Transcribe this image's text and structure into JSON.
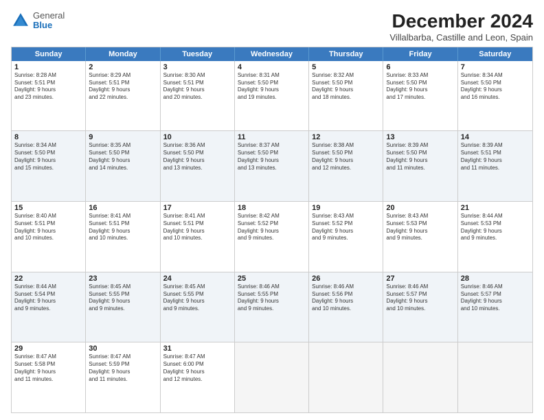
{
  "logo": {
    "general": "General",
    "blue": "Blue"
  },
  "title": "December 2024",
  "subtitle": "Villalbarba, Castille and Leon, Spain",
  "header_days": [
    "Sunday",
    "Monday",
    "Tuesday",
    "Wednesday",
    "Thursday",
    "Friday",
    "Saturday"
  ],
  "rows": [
    [
      {
        "day": "1",
        "lines": [
          "Sunrise: 8:28 AM",
          "Sunset: 5:51 PM",
          "Daylight: 9 hours",
          "and 23 minutes."
        ],
        "alt": false
      },
      {
        "day": "2",
        "lines": [
          "Sunrise: 8:29 AM",
          "Sunset: 5:51 PM",
          "Daylight: 9 hours",
          "and 22 minutes."
        ],
        "alt": false
      },
      {
        "day": "3",
        "lines": [
          "Sunrise: 8:30 AM",
          "Sunset: 5:51 PM",
          "Daylight: 9 hours",
          "and 20 minutes."
        ],
        "alt": false
      },
      {
        "day": "4",
        "lines": [
          "Sunrise: 8:31 AM",
          "Sunset: 5:50 PM",
          "Daylight: 9 hours",
          "and 19 minutes."
        ],
        "alt": false
      },
      {
        "day": "5",
        "lines": [
          "Sunrise: 8:32 AM",
          "Sunset: 5:50 PM",
          "Daylight: 9 hours",
          "and 18 minutes."
        ],
        "alt": false
      },
      {
        "day": "6",
        "lines": [
          "Sunrise: 8:33 AM",
          "Sunset: 5:50 PM",
          "Daylight: 9 hours",
          "and 17 minutes."
        ],
        "alt": false
      },
      {
        "day": "7",
        "lines": [
          "Sunrise: 8:34 AM",
          "Sunset: 5:50 PM",
          "Daylight: 9 hours",
          "and 16 minutes."
        ],
        "alt": false
      }
    ],
    [
      {
        "day": "8",
        "lines": [
          "Sunrise: 8:34 AM",
          "Sunset: 5:50 PM",
          "Daylight: 9 hours",
          "and 15 minutes."
        ],
        "alt": true
      },
      {
        "day": "9",
        "lines": [
          "Sunrise: 8:35 AM",
          "Sunset: 5:50 PM",
          "Daylight: 9 hours",
          "and 14 minutes."
        ],
        "alt": true
      },
      {
        "day": "10",
        "lines": [
          "Sunrise: 8:36 AM",
          "Sunset: 5:50 PM",
          "Daylight: 9 hours",
          "and 13 minutes."
        ],
        "alt": true
      },
      {
        "day": "11",
        "lines": [
          "Sunrise: 8:37 AM",
          "Sunset: 5:50 PM",
          "Daylight: 9 hours",
          "and 13 minutes."
        ],
        "alt": true
      },
      {
        "day": "12",
        "lines": [
          "Sunrise: 8:38 AM",
          "Sunset: 5:50 PM",
          "Daylight: 9 hours",
          "and 12 minutes."
        ],
        "alt": true
      },
      {
        "day": "13",
        "lines": [
          "Sunrise: 8:39 AM",
          "Sunset: 5:50 PM",
          "Daylight: 9 hours",
          "and 11 minutes."
        ],
        "alt": true
      },
      {
        "day": "14",
        "lines": [
          "Sunrise: 8:39 AM",
          "Sunset: 5:51 PM",
          "Daylight: 9 hours",
          "and 11 minutes."
        ],
        "alt": true
      }
    ],
    [
      {
        "day": "15",
        "lines": [
          "Sunrise: 8:40 AM",
          "Sunset: 5:51 PM",
          "Daylight: 9 hours",
          "and 10 minutes."
        ],
        "alt": false
      },
      {
        "day": "16",
        "lines": [
          "Sunrise: 8:41 AM",
          "Sunset: 5:51 PM",
          "Daylight: 9 hours",
          "and 10 minutes."
        ],
        "alt": false
      },
      {
        "day": "17",
        "lines": [
          "Sunrise: 8:41 AM",
          "Sunset: 5:51 PM",
          "Daylight: 9 hours",
          "and 10 minutes."
        ],
        "alt": false
      },
      {
        "day": "18",
        "lines": [
          "Sunrise: 8:42 AM",
          "Sunset: 5:52 PM",
          "Daylight: 9 hours",
          "and 9 minutes."
        ],
        "alt": false
      },
      {
        "day": "19",
        "lines": [
          "Sunrise: 8:43 AM",
          "Sunset: 5:52 PM",
          "Daylight: 9 hours",
          "and 9 minutes."
        ],
        "alt": false
      },
      {
        "day": "20",
        "lines": [
          "Sunrise: 8:43 AM",
          "Sunset: 5:53 PM",
          "Daylight: 9 hours",
          "and 9 minutes."
        ],
        "alt": false
      },
      {
        "day": "21",
        "lines": [
          "Sunrise: 8:44 AM",
          "Sunset: 5:53 PM",
          "Daylight: 9 hours",
          "and 9 minutes."
        ],
        "alt": false
      }
    ],
    [
      {
        "day": "22",
        "lines": [
          "Sunrise: 8:44 AM",
          "Sunset: 5:54 PM",
          "Daylight: 9 hours",
          "and 9 minutes."
        ],
        "alt": true
      },
      {
        "day": "23",
        "lines": [
          "Sunrise: 8:45 AM",
          "Sunset: 5:55 PM",
          "Daylight: 9 hours",
          "and 9 minutes."
        ],
        "alt": true
      },
      {
        "day": "24",
        "lines": [
          "Sunrise: 8:45 AM",
          "Sunset: 5:55 PM",
          "Daylight: 9 hours",
          "and 9 minutes."
        ],
        "alt": true
      },
      {
        "day": "25",
        "lines": [
          "Sunrise: 8:46 AM",
          "Sunset: 5:55 PM",
          "Daylight: 9 hours",
          "and 9 minutes."
        ],
        "alt": true
      },
      {
        "day": "26",
        "lines": [
          "Sunrise: 8:46 AM",
          "Sunset: 5:56 PM",
          "Daylight: 9 hours",
          "and 10 minutes."
        ],
        "alt": true
      },
      {
        "day": "27",
        "lines": [
          "Sunrise: 8:46 AM",
          "Sunset: 5:57 PM",
          "Daylight: 9 hours",
          "and 10 minutes."
        ],
        "alt": true
      },
      {
        "day": "28",
        "lines": [
          "Sunrise: 8:46 AM",
          "Sunset: 5:57 PM",
          "Daylight: 9 hours",
          "and 10 minutes."
        ],
        "alt": true
      }
    ],
    [
      {
        "day": "29",
        "lines": [
          "Sunrise: 8:47 AM",
          "Sunset: 5:58 PM",
          "Daylight: 9 hours",
          "and 11 minutes."
        ],
        "alt": false
      },
      {
        "day": "30",
        "lines": [
          "Sunrise: 8:47 AM",
          "Sunset: 5:59 PM",
          "Daylight: 9 hours",
          "and 11 minutes."
        ],
        "alt": false
      },
      {
        "day": "31",
        "lines": [
          "Sunrise: 8:47 AM",
          "Sunset: 6:00 PM",
          "Daylight: 9 hours",
          "and 12 minutes."
        ],
        "alt": false
      },
      {
        "day": "",
        "lines": [],
        "alt": false,
        "empty": true
      },
      {
        "day": "",
        "lines": [],
        "alt": false,
        "empty": true
      },
      {
        "day": "",
        "lines": [],
        "alt": false,
        "empty": true
      },
      {
        "day": "",
        "lines": [],
        "alt": false,
        "empty": true
      }
    ]
  ]
}
